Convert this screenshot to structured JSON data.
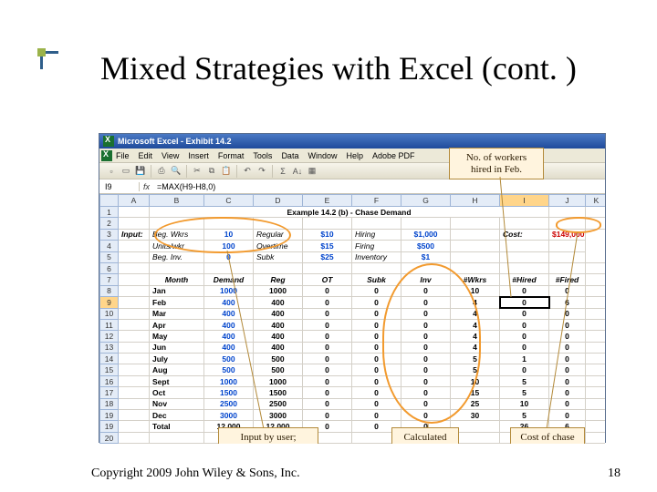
{
  "slide": {
    "title": "Mixed Strategies with Excel (cont. )",
    "copyright": "Copyright 2009 John Wiley & Sons, Inc.",
    "page": "18"
  },
  "excel": {
    "window_title": "Microsoft Excel - Exhibit 14.2",
    "menu": [
      "File",
      "Edit",
      "View",
      "Insert",
      "Format",
      "Tools",
      "Data",
      "Window",
      "Help",
      "Adobe PDF"
    ],
    "namebox": "I9",
    "formula": "=MAX(H9-H8,0)",
    "sheet_title": "Example 14.2 (b) - Chase Demand",
    "columns": [
      "A",
      "B",
      "C",
      "D",
      "E",
      "F",
      "G",
      "H",
      "I",
      "J",
      "K"
    ],
    "input_block": {
      "input_label": "Input:",
      "rows": [
        {
          "l": "Beg. Wkrs",
          "v": "10",
          "l2": "Regular",
          "v2": "$10",
          "l3": "Hiring",
          "v3": "$1,000"
        },
        {
          "l": "Units/wkr",
          "v": "100",
          "l2": "Overtime",
          "v2": "$15",
          "l3": "Firing",
          "v3": "$500"
        },
        {
          "l": "Beg. Inv.",
          "v": "0",
          "l2": "Subk",
          "v2": "$25",
          "l3": "Inventory",
          "v3": "$1"
        }
      ],
      "cost_label": "Cost:",
      "cost_value": "$149,000"
    },
    "headers": [
      "Month",
      "Demand",
      "Reg",
      "OT",
      "Subk",
      "Inv",
      "#Wkrs",
      "#Hired",
      "#Fired"
    ],
    "months": [
      {
        "m": "Jan",
        "d": "1000",
        "r": "1000",
        "o": "0",
        "s": "0",
        "i": "0",
        "w": "10",
        "h": "0",
        "f": "0"
      },
      {
        "m": "Feb",
        "d": "400",
        "r": "400",
        "o": "0",
        "s": "0",
        "i": "0",
        "w": "4",
        "h": "0",
        "f": "6"
      },
      {
        "m": "Mar",
        "d": "400",
        "r": "400",
        "o": "0",
        "s": "0",
        "i": "0",
        "w": "4",
        "h": "0",
        "f": "0"
      },
      {
        "m": "Apr",
        "d": "400",
        "r": "400",
        "o": "0",
        "s": "0",
        "i": "0",
        "w": "4",
        "h": "0",
        "f": "0"
      },
      {
        "m": "May",
        "d": "400",
        "r": "400",
        "o": "0",
        "s": "0",
        "i": "0",
        "w": "4",
        "h": "0",
        "f": "0"
      },
      {
        "m": "Jun",
        "d": "400",
        "r": "400",
        "o": "0",
        "s": "0",
        "i": "0",
        "w": "4",
        "h": "0",
        "f": "0"
      },
      {
        "m": "July",
        "d": "500",
        "r": "500",
        "o": "0",
        "s": "0",
        "i": "0",
        "w": "5",
        "h": "1",
        "f": "0"
      },
      {
        "m": "Aug",
        "d": "500",
        "r": "500",
        "o": "0",
        "s": "0",
        "i": "0",
        "w": "5",
        "h": "0",
        "f": "0"
      },
      {
        "m": "Sept",
        "d": "1000",
        "r": "1000",
        "o": "0",
        "s": "0",
        "i": "0",
        "w": "10",
        "h": "5",
        "f": "0"
      },
      {
        "m": "Oct",
        "d": "1500",
        "r": "1500",
        "o": "0",
        "s": "0",
        "i": "0",
        "w": "15",
        "h": "5",
        "f": "0"
      },
      {
        "m": "Nov",
        "d": "2500",
        "r": "2500",
        "o": "0",
        "s": "0",
        "i": "0",
        "w": "25",
        "h": "10",
        "f": "0"
      },
      {
        "m": "Dec",
        "d": "3000",
        "r": "3000",
        "o": "0",
        "s": "0",
        "i": "0",
        "w": "30",
        "h": "5",
        "f": "0"
      }
    ],
    "total": {
      "label": "Total",
      "d": "12,000",
      "r": "12,000",
      "o": "0",
      "s": "0",
      "i": "0",
      "w": "",
      "h": "26",
      "f": "6"
    }
  },
  "callouts": {
    "hired_feb": "No. of workers hired in Feb.",
    "input_by_user": "Input by user; production = demand",
    "calc_by_excel": "Calculated by Excel",
    "cost_of_chase": "Cost of chase demand"
  }
}
